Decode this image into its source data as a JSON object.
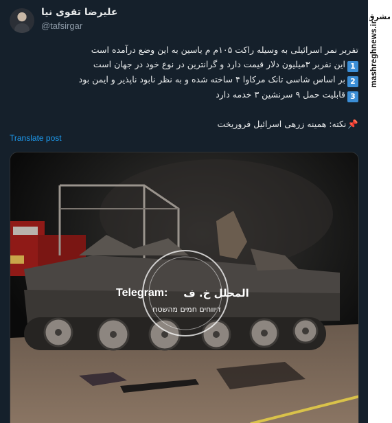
{
  "author": {
    "display_name": "علیرضا تقوی نیا",
    "handle": "@tafsirgar"
  },
  "tweet": {
    "headline": "تفربر نمر اسرائیلی به وسیله راکت ۱۰۵م م یاسین به این وضع درآمده است",
    "points": [
      {
        "num": "1",
        "text": "این نفربر ۳میلیون دلار قیمت دارد و گرانترین در نوع خود در جهان است"
      },
      {
        "num": "2",
        "text": "بر اساس شاسی تانک مرکاوا ۴ ساخته شده و به نظر نابود ناپذیر و ایمن بود"
      },
      {
        "num": "3",
        "text": "قابلیت حمل ۹ سرنشین ۳ خدمه دارد"
      }
    ],
    "note_icon": "pushpin-icon",
    "note": "نکته: همینه زرهی اسرائیل فروریخت",
    "translate_label": "Translate post"
  },
  "media": {
    "watermark_source": "Telegram:",
    "watermark_name": "المحلل خ. ف",
    "watermark_subtitle": "דיווחים חמים מהשטח"
  },
  "branding": {
    "logo_text": "مشرق",
    "site_url": "mashreghnews.ir"
  },
  "colors": {
    "background": "#15202b",
    "link": "#1d9bf0",
    "badge": "#3b8ed6"
  }
}
